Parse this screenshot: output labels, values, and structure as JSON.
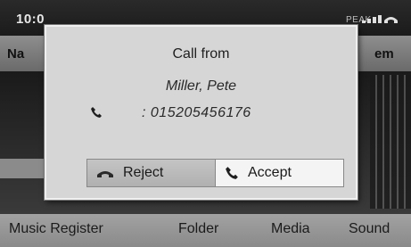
{
  "status": {
    "clock": "10:0",
    "network": "PEAK"
  },
  "tabs": {
    "left_partial": "Na",
    "right_partial": "em"
  },
  "bottom_menu": [
    "Music Register",
    "Folder",
    "Media",
    "Sound"
  ],
  "dialog": {
    "title": "Call from",
    "caller_name": "Miller, Pete",
    "number": ": 015205456176",
    "reject_label": "Reject",
    "accept_label": "Accept",
    "selected_button": "Accept"
  },
  "colors": {
    "dialog_bg": "#d6d6d6",
    "accept_highlight": "#f4f4f4"
  },
  "icons": {
    "phone": "phone-handset-icon",
    "reject": "hang-up-icon",
    "accept": "pick-up-icon"
  }
}
